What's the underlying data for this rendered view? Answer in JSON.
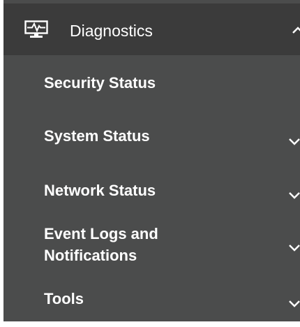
{
  "menu": {
    "header": {
      "label": "Diagnostics",
      "icon": "monitor-heartbeat-icon",
      "state": "expanded"
    },
    "items": [
      {
        "label": "Security Status",
        "has_submenu": false
      },
      {
        "label": "System Status",
        "has_submenu": true
      },
      {
        "label": "Network Status",
        "has_submenu": true
      },
      {
        "label_lines": [
          "Event Logs and",
          "Notifications"
        ],
        "has_submenu": true
      },
      {
        "label": "Tools",
        "has_submenu": true
      }
    ]
  },
  "colors": {
    "panel_bg": "#4b4c4c",
    "header_bg": "#3b3b3b",
    "text": "#ffffff"
  }
}
